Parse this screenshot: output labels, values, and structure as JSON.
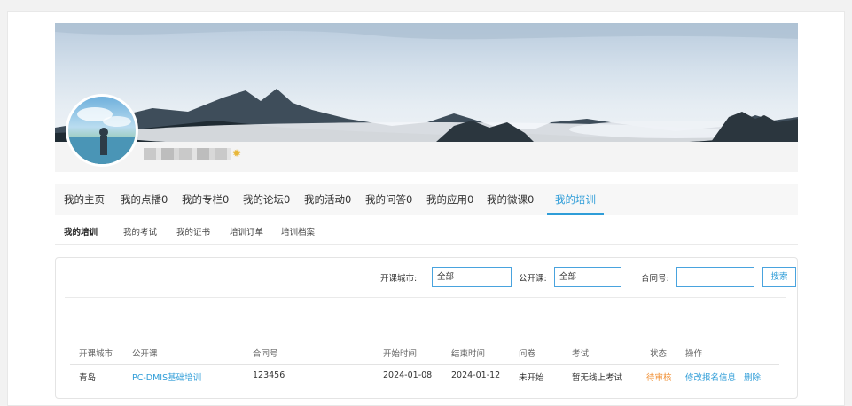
{
  "main_nav": [
    {
      "label": "我的主页",
      "active": false
    },
    {
      "label": "我的点播0",
      "active": false
    },
    {
      "label": "我的专栏0",
      "active": false
    },
    {
      "label": "我的论坛0",
      "active": false
    },
    {
      "label": "我的活动0",
      "active": false
    },
    {
      "label": "我的问答0",
      "active": false
    },
    {
      "label": "我的应用0",
      "active": false
    },
    {
      "label": "我的微课0",
      "active": false
    },
    {
      "label": "我的培训",
      "active": true
    }
  ],
  "sub_nav": [
    {
      "label": "我的培训",
      "active": true
    },
    {
      "label": "我的考试",
      "active": false
    },
    {
      "label": "我的证书",
      "active": false
    },
    {
      "label": "培训订单",
      "active": false
    },
    {
      "label": "培训档案",
      "active": false
    }
  ],
  "filters": {
    "city_label": "开课城市:",
    "city_value": "全部",
    "public_label": "公开课:",
    "public_value": "全部",
    "contract_label": "合同号:",
    "contract_value": "",
    "search_label": "搜索"
  },
  "table": {
    "headers": [
      "开课城市",
      "公开课",
      "合同号",
      "开始时间",
      "结束时间",
      "问卷",
      "考试",
      "状态",
      "操作"
    ],
    "rows": [
      {
        "city": "青岛",
        "course": "PC-DMIS基础培训",
        "contract": "123456",
        "start": "2024-01-08",
        "end": "2024-01-12",
        "survey": "未开始",
        "exam": "暂无线上考试",
        "status": "待审核",
        "action_edit": "修改报名信息",
        "action_delete": "删除"
      }
    ]
  },
  "colors": {
    "accent": "#2f9dd8",
    "pending": "#f08c2e"
  },
  "icons": {
    "badge": "gear-badge-icon"
  }
}
